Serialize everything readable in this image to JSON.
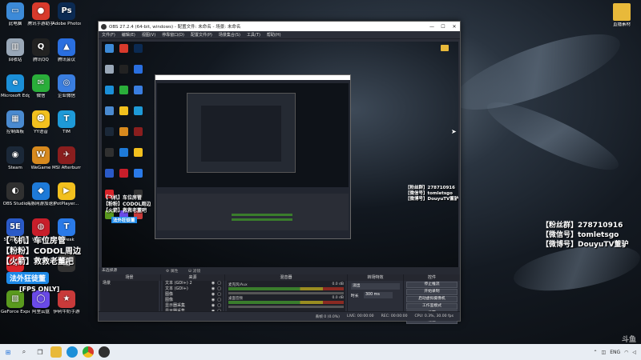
{
  "desktop": {
    "icons": [
      {
        "label": "此电脑",
        "name": "this-pc-icon",
        "col": 0,
        "row": 0,
        "bg": "#3c8ad8",
        "glyph": "▭"
      },
      {
        "label": "腾讯手游助手",
        "name": "tencent-mobile-assistant-icon",
        "col": 1,
        "row": 0,
        "bg": "#d83a2c",
        "glyph": "●"
      },
      {
        "label": "Adobe Photosh...",
        "name": "photoshop-icon",
        "col": 2,
        "row": 0,
        "bg": "#0b2a52",
        "glyph": "Ps"
      },
      {
        "label": "回收站",
        "name": "recycle-bin-icon",
        "col": 0,
        "row": 1,
        "bg": "#9aa8b8",
        "glyph": "▥"
      },
      {
        "label": "腾讯QQ",
        "name": "qq-icon",
        "col": 1,
        "row": 1,
        "bg": "#222",
        "glyph": "Q"
      },
      {
        "label": "腾讯会议",
        "name": "tencent-meeting-icon",
        "col": 2,
        "row": 1,
        "bg": "#2a6fe0",
        "glyph": "▲"
      },
      {
        "label": "Microsoft Edge",
        "name": "edge-icon",
        "col": 0,
        "row": 2,
        "bg": "#1b8fd8",
        "glyph": "e"
      },
      {
        "label": "微信",
        "name": "wechat-icon",
        "col": 1,
        "row": 2,
        "bg": "#2aae3a",
        "glyph": "✉"
      },
      {
        "label": "企业微信",
        "name": "wecom-icon",
        "col": 2,
        "row": 2,
        "bg": "#3a7ee0",
        "glyph": "◎"
      },
      {
        "label": "控制面板",
        "name": "control-panel-icon",
        "col": 0,
        "row": 3,
        "bg": "#4a8ad0",
        "glyph": "▦"
      },
      {
        "label": "YY语音",
        "name": "yy-voice-icon",
        "col": 1,
        "row": 3,
        "bg": "#f2c01e",
        "glyph": "☻"
      },
      {
        "label": "TIM",
        "name": "tim-icon",
        "col": 2,
        "row": 3,
        "bg": "#1e9ad8",
        "glyph": "T"
      },
      {
        "label": "Steam",
        "name": "steam-icon",
        "col": 0,
        "row": 4,
        "bg": "#1b2838",
        "glyph": "◉"
      },
      {
        "label": "WeGame",
        "name": "wegame-icon",
        "col": 1,
        "row": 4,
        "bg": "#d88a1e",
        "glyph": "W"
      },
      {
        "label": "MSI Afterburner",
        "name": "msi-afterburner-icon",
        "col": 2,
        "row": 4,
        "bg": "#8a1e1e",
        "glyph": "✈"
      },
      {
        "label": "OBS Studio",
        "name": "obs-studio-icon",
        "col": 0,
        "row": 5,
        "bg": "#303030",
        "glyph": "◐"
      },
      {
        "label": "海豚网游加速器5.0",
        "name": "dolphin-accelerator-icon",
        "col": 1,
        "row": 5,
        "bg": "#1e7ad8",
        "glyph": "◆"
      },
      {
        "label": "PotPlayer...",
        "name": "potplayer-icon",
        "col": 2,
        "row": 5,
        "bg": "#f2c01e",
        "glyph": "▶"
      },
      {
        "label": "5E对战平台",
        "name": "5e-platform-icon",
        "col": 0,
        "row": 6,
        "bg": "#2a5ac8",
        "glyph": "5E"
      },
      {
        "label": "WePLAY",
        "name": "weplay-icon",
        "col": 1,
        "row": 6,
        "bg": "#c81e2a",
        "glyph": "◍"
      },
      {
        "label": "ToDesk",
        "name": "todesk-icon",
        "col": 2,
        "row": 6,
        "bg": "#2a7ae8",
        "glyph": "T"
      },
      {
        "label": "网易云",
        "name": "netease-icon",
        "col": 0,
        "row": 7,
        "bg": "#d8242a",
        "glyph": "♫"
      },
      {
        "label": "",
        "name": "unlabeled-app-icon",
        "col": 2,
        "row": 7,
        "bg": "#333",
        "glyph": "▣"
      },
      {
        "label": "GeForce Experience",
        "name": "geforce-icon",
        "col": 0,
        "row": 8,
        "bg": "#5a9a1e",
        "glyph": "▧"
      },
      {
        "label": "阿里云盘",
        "name": "aliyun-drive-icon",
        "col": 1,
        "row": 8,
        "bg": "#6a4ae8",
        "glyph": "◯"
      },
      {
        "label": "伊利牛奶手游",
        "name": "mobile-game-icon",
        "col": 2,
        "row": 8,
        "bg": "#c83a3a",
        "glyph": "★"
      }
    ],
    "folder": {
      "label": "直播素材"
    }
  },
  "obs": {
    "title": "OBS 27.2.4 (64-bit, windows) - 配置文件: 未命名 - 场景: 未命名",
    "menus": [
      "文件(F)",
      "编辑(E)",
      "视图(V)",
      "停靠窗口(D)",
      "配置文件(P)",
      "场景集合(S)",
      "工具(T)",
      "帮助(H)"
    ],
    "docks": {
      "scenes": {
        "title": "场景",
        "items": [
          "场景"
        ]
      },
      "sources": {
        "title": "来源",
        "items": [
          "文本 (GDI+) 2",
          "文本 (GDI+)",
          "图像",
          "图像",
          "显示器采集",
          "显示器采集"
        ]
      },
      "mixer": {
        "title": "混音器",
        "channels": [
          {
            "name": "麦克风/Aux",
            "db": "0.0 dB"
          },
          {
            "name": "桌面音频",
            "db": "0.0 dB"
          }
        ]
      },
      "transitions": {
        "title": "转场特效",
        "type": "淡出",
        "duration_label": "时长",
        "duration": "300 ms"
      },
      "controls": {
        "title": "控件",
        "buttons": [
          "停止推流",
          "开始录制",
          "启动虚拟摄像机",
          "工作室模式",
          "设置",
          "退出"
        ]
      }
    },
    "status": {
      "drop": "丢帧 0 (0.0%)",
      "live": "LIVE: 00:00:00",
      "rec": "REC: 00:00:00",
      "cpu": "CPU: 0.3%, 30.00 fps"
    },
    "selection_note": "未选择源"
  },
  "overlay": {
    "info_lines": [
      "【粉丝群】278710916",
      "【微信号】tomletsgo",
      "【微博号】DouyuTV董驴"
    ],
    "broadcast_lines": [
      "【飞机】车位房管",
      "【粉粉】CODOL周边",
      "【火箭】救救老董吧"
    ],
    "fps_badge": "法外狂徒董",
    "fps_tag": "[FPS ONLY]",
    "corner_text": "斗鱼"
  },
  "taskbar": {
    "tray_lang": "ENG",
    "apps": [
      "start-icon",
      "search-icon",
      "task-view-icon",
      "file-explorer-icon",
      "edge-taskbar-icon",
      "chrome-taskbar-icon",
      "obs-taskbar-icon"
    ]
  }
}
